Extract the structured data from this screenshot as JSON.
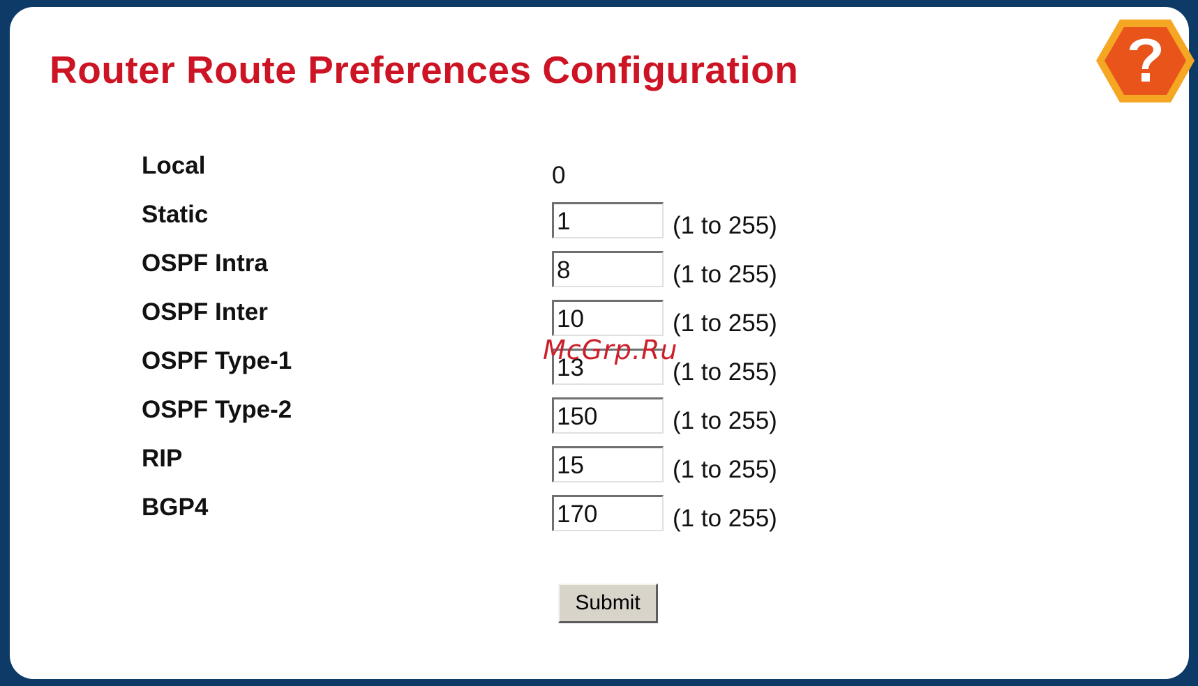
{
  "header": {
    "title": "Router Route Preferences Configuration",
    "help_icon": "question-mark-hexagon-icon"
  },
  "form": {
    "local": {
      "label": "Local",
      "value": "0"
    },
    "fields": [
      {
        "label": "Static",
        "value": "1",
        "range": "(1 to 255)"
      },
      {
        "label": "OSPF Intra",
        "value": "8",
        "range": "(1 to 255)"
      },
      {
        "label": "OSPF Inter",
        "value": "10",
        "range": "(1 to 255)"
      },
      {
        "label": "OSPF Type-1",
        "value": "13",
        "range": "(1 to 255)"
      },
      {
        "label": "OSPF Type-2",
        "value": "150",
        "range": "(1 to 255)"
      },
      {
        "label": "RIP",
        "value": "15",
        "range": "(1 to 255)"
      },
      {
        "label": "BGP4",
        "value": "170",
        "range": "(1 to 255)"
      }
    ],
    "submit_label": "Submit"
  },
  "watermark": "McGrp.Ru",
  "colors": {
    "frame": "#0d3a66",
    "title": "#cc1424",
    "help_outer": "#f5a623",
    "help_inner": "#e8541a"
  }
}
